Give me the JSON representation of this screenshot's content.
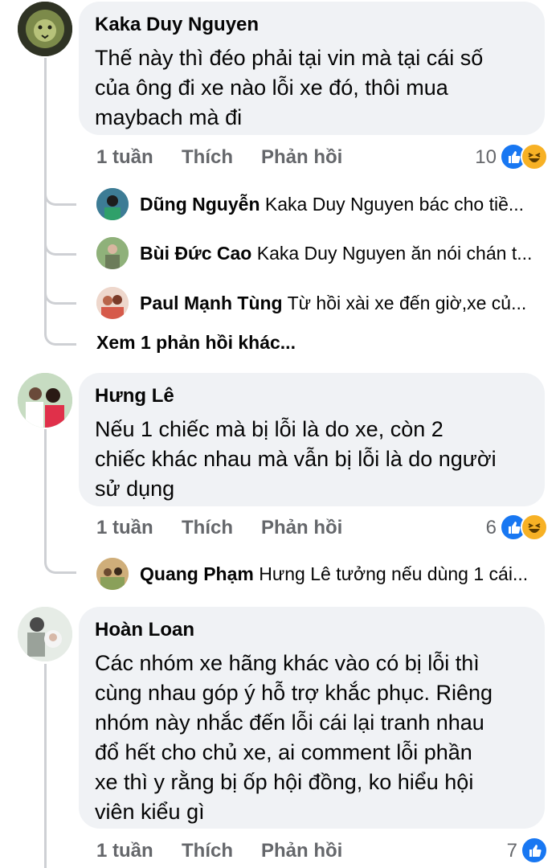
{
  "comments": [
    {
      "author": "Kaka Duy Nguyen",
      "text_lines": [
        "Thế này thì đéo phải tại vin mà tại cái số",
        "của ông đi xe nào lỗi xe đó, thôi mua",
        "maybach mà đi"
      ],
      "time": "1 tuần",
      "like_label": "Thích",
      "reply_label": "Phản hồi",
      "reaction_count": "10",
      "reactions": [
        "like-icon",
        "haha-icon"
      ],
      "replies": [
        {
          "author": "Dũng Nguyễn",
          "preview": "Kaka Duy Nguyen bác cho tiề..."
        },
        {
          "author": "Bùi Đức Cao",
          "preview": "Kaka Duy Nguyen ăn nói chán t..."
        },
        {
          "author": "Paul Mạnh Tùng",
          "preview": "Từ hồi xài xe đến giờ,xe củ..."
        }
      ],
      "more_replies": "Xem 1 phản hồi khác..."
    },
    {
      "author": "Hưng Lê",
      "text_lines": [
        "Nếu 1 chiếc mà bị lỗi là do xe, còn 2",
        "chiếc khác nhau mà vẫn bị lỗi là do người",
        "sử dụng"
      ],
      "time": "1 tuần",
      "like_label": "Thích",
      "reply_label": "Phản hồi",
      "reaction_count": "6",
      "reactions": [
        "like-icon",
        "haha-icon"
      ],
      "replies": [
        {
          "author": "Quang Phạm",
          "preview": "Hưng Lê tưởng nếu dùng 1 cái..."
        }
      ]
    },
    {
      "author": "Hoàn Loan",
      "text_lines": [
        "Các nhóm xe hãng khác vào có bị lỗi thì",
        "cùng nhau góp ý hỗ trợ khắc phục. Riêng",
        "nhóm này nhắc đến lỗi cái lại tranh nhau",
        "đổ hết cho chủ xe, ai comment lỗi phần",
        "xe thì y rằng bị ốp hội đồng, ko hiểu hội",
        "viên kiểu gì"
      ],
      "time": "1 tuần",
      "like_label": "Thích",
      "reply_label": "Phản hồi",
      "reaction_count": "7",
      "reactions": [
        "like-icon"
      ]
    }
  ],
  "colors": {
    "bubble": "#f0f2f5",
    "secondary_text": "#65676b",
    "like_blue": "#1877f2",
    "haha_yellow": "#f7b125",
    "thread_line": "#ced0d4"
  }
}
